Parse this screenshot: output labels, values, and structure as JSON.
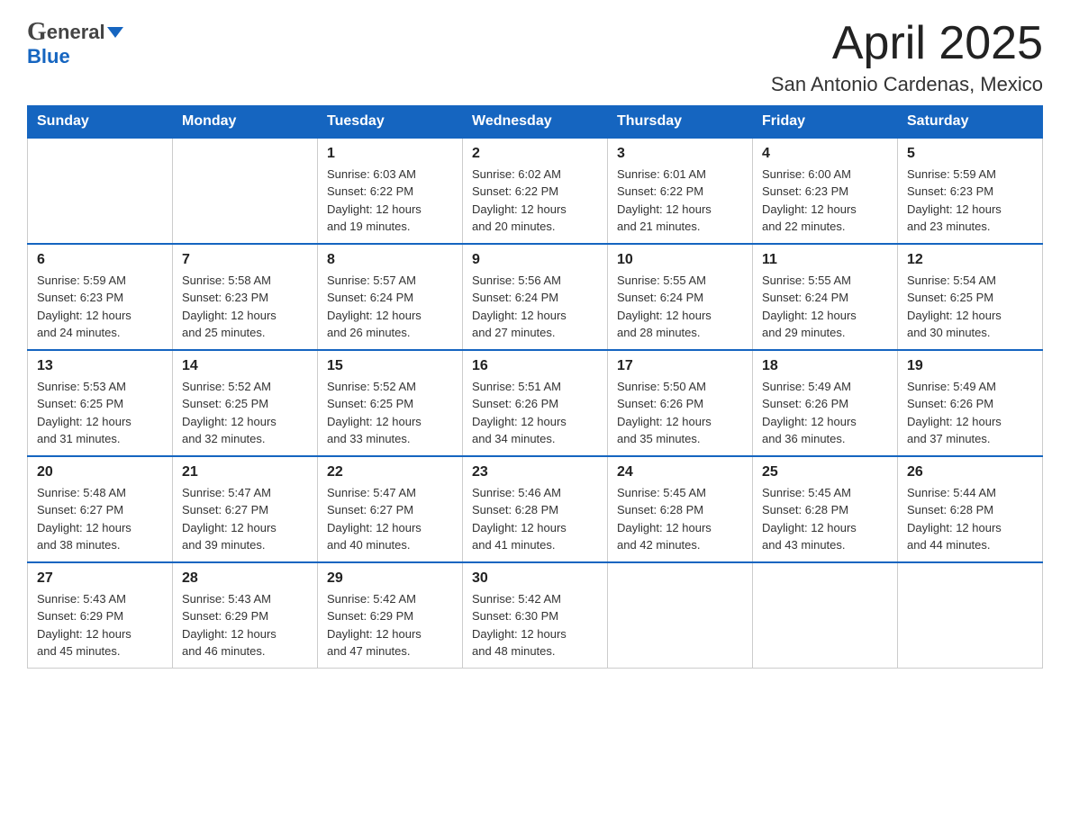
{
  "header": {
    "logo_general": "General",
    "logo_blue": "Blue",
    "month_year": "April 2025",
    "location": "San Antonio Cardenas, Mexico"
  },
  "weekdays": [
    "Sunday",
    "Monday",
    "Tuesday",
    "Wednesday",
    "Thursday",
    "Friday",
    "Saturday"
  ],
  "weeks": [
    [
      {
        "day": "",
        "info": ""
      },
      {
        "day": "",
        "info": ""
      },
      {
        "day": "1",
        "info": "Sunrise: 6:03 AM\nSunset: 6:22 PM\nDaylight: 12 hours\nand 19 minutes."
      },
      {
        "day": "2",
        "info": "Sunrise: 6:02 AM\nSunset: 6:22 PM\nDaylight: 12 hours\nand 20 minutes."
      },
      {
        "day": "3",
        "info": "Sunrise: 6:01 AM\nSunset: 6:22 PM\nDaylight: 12 hours\nand 21 minutes."
      },
      {
        "day": "4",
        "info": "Sunrise: 6:00 AM\nSunset: 6:23 PM\nDaylight: 12 hours\nand 22 minutes."
      },
      {
        "day": "5",
        "info": "Sunrise: 5:59 AM\nSunset: 6:23 PM\nDaylight: 12 hours\nand 23 minutes."
      }
    ],
    [
      {
        "day": "6",
        "info": "Sunrise: 5:59 AM\nSunset: 6:23 PM\nDaylight: 12 hours\nand 24 minutes."
      },
      {
        "day": "7",
        "info": "Sunrise: 5:58 AM\nSunset: 6:23 PM\nDaylight: 12 hours\nand 25 minutes."
      },
      {
        "day": "8",
        "info": "Sunrise: 5:57 AM\nSunset: 6:24 PM\nDaylight: 12 hours\nand 26 minutes."
      },
      {
        "day": "9",
        "info": "Sunrise: 5:56 AM\nSunset: 6:24 PM\nDaylight: 12 hours\nand 27 minutes."
      },
      {
        "day": "10",
        "info": "Sunrise: 5:55 AM\nSunset: 6:24 PM\nDaylight: 12 hours\nand 28 minutes."
      },
      {
        "day": "11",
        "info": "Sunrise: 5:55 AM\nSunset: 6:24 PM\nDaylight: 12 hours\nand 29 minutes."
      },
      {
        "day": "12",
        "info": "Sunrise: 5:54 AM\nSunset: 6:25 PM\nDaylight: 12 hours\nand 30 minutes."
      }
    ],
    [
      {
        "day": "13",
        "info": "Sunrise: 5:53 AM\nSunset: 6:25 PM\nDaylight: 12 hours\nand 31 minutes."
      },
      {
        "day": "14",
        "info": "Sunrise: 5:52 AM\nSunset: 6:25 PM\nDaylight: 12 hours\nand 32 minutes."
      },
      {
        "day": "15",
        "info": "Sunrise: 5:52 AM\nSunset: 6:25 PM\nDaylight: 12 hours\nand 33 minutes."
      },
      {
        "day": "16",
        "info": "Sunrise: 5:51 AM\nSunset: 6:26 PM\nDaylight: 12 hours\nand 34 minutes."
      },
      {
        "day": "17",
        "info": "Sunrise: 5:50 AM\nSunset: 6:26 PM\nDaylight: 12 hours\nand 35 minutes."
      },
      {
        "day": "18",
        "info": "Sunrise: 5:49 AM\nSunset: 6:26 PM\nDaylight: 12 hours\nand 36 minutes."
      },
      {
        "day": "19",
        "info": "Sunrise: 5:49 AM\nSunset: 6:26 PM\nDaylight: 12 hours\nand 37 minutes."
      }
    ],
    [
      {
        "day": "20",
        "info": "Sunrise: 5:48 AM\nSunset: 6:27 PM\nDaylight: 12 hours\nand 38 minutes."
      },
      {
        "day": "21",
        "info": "Sunrise: 5:47 AM\nSunset: 6:27 PM\nDaylight: 12 hours\nand 39 minutes."
      },
      {
        "day": "22",
        "info": "Sunrise: 5:47 AM\nSunset: 6:27 PM\nDaylight: 12 hours\nand 40 minutes."
      },
      {
        "day": "23",
        "info": "Sunrise: 5:46 AM\nSunset: 6:28 PM\nDaylight: 12 hours\nand 41 minutes."
      },
      {
        "day": "24",
        "info": "Sunrise: 5:45 AM\nSunset: 6:28 PM\nDaylight: 12 hours\nand 42 minutes."
      },
      {
        "day": "25",
        "info": "Sunrise: 5:45 AM\nSunset: 6:28 PM\nDaylight: 12 hours\nand 43 minutes."
      },
      {
        "day": "26",
        "info": "Sunrise: 5:44 AM\nSunset: 6:28 PM\nDaylight: 12 hours\nand 44 minutes."
      }
    ],
    [
      {
        "day": "27",
        "info": "Sunrise: 5:43 AM\nSunset: 6:29 PM\nDaylight: 12 hours\nand 45 minutes."
      },
      {
        "day": "28",
        "info": "Sunrise: 5:43 AM\nSunset: 6:29 PM\nDaylight: 12 hours\nand 46 minutes."
      },
      {
        "day": "29",
        "info": "Sunrise: 5:42 AM\nSunset: 6:29 PM\nDaylight: 12 hours\nand 47 minutes."
      },
      {
        "day": "30",
        "info": "Sunrise: 5:42 AM\nSunset: 6:30 PM\nDaylight: 12 hours\nand 48 minutes."
      },
      {
        "day": "",
        "info": ""
      },
      {
        "day": "",
        "info": ""
      },
      {
        "day": "",
        "info": ""
      }
    ]
  ]
}
